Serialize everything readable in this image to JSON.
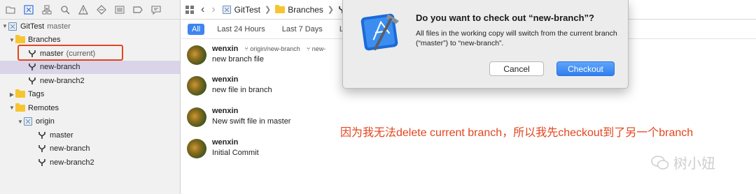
{
  "sidebar": {
    "toolbar_icons": [
      "folder-icon",
      "source-control-icon",
      "hierarchy-icon",
      "search-icon",
      "warning-icon",
      "test-diamond-icon",
      "debug-icon",
      "breakpoint-icon",
      "report-icon"
    ],
    "repo": {
      "name": "GitTest",
      "branch": "master"
    },
    "branches_label": "Branches",
    "branches": [
      {
        "name": "master",
        "note": "(current)"
      },
      {
        "name": "new-branch",
        "selected": true
      },
      {
        "name": "new-branch2"
      }
    ],
    "tags_label": "Tags",
    "remotes_label": "Remotes",
    "remote_name": "origin",
    "remote_branches": [
      "master",
      "new-branch",
      "new-branch2"
    ]
  },
  "breadcrumb": {
    "repo": "GitTest",
    "folder": "Branches"
  },
  "filters": [
    "All",
    "Last 24 Hours",
    "Last 7 Days",
    "La"
  ],
  "commits": [
    {
      "author": "wenxin",
      "tags": [
        "origin/new-branch",
        "new-"
      ],
      "message": "new branch file"
    },
    {
      "author": "wenxin",
      "message": "new file in branch"
    },
    {
      "author": "wenxin",
      "message": "New swift file in master"
    },
    {
      "author": "wenxin",
      "message": "Initial Commit"
    }
  ],
  "dialog": {
    "title": "Do you want to check out “new-branch”?",
    "body": "All files in the working copy will switch from the current branch (“master”) to “new-branch”.",
    "cancel": "Cancel",
    "confirm": "Checkout"
  },
  "annotation": "因为我无法delete current branch，所以我先checkout到了另一个branch",
  "watermark": "树小妞",
  "colors": {
    "accent": "#3d85f0",
    "annotation": "#e2451d",
    "selection": "#d9d4e8"
  }
}
